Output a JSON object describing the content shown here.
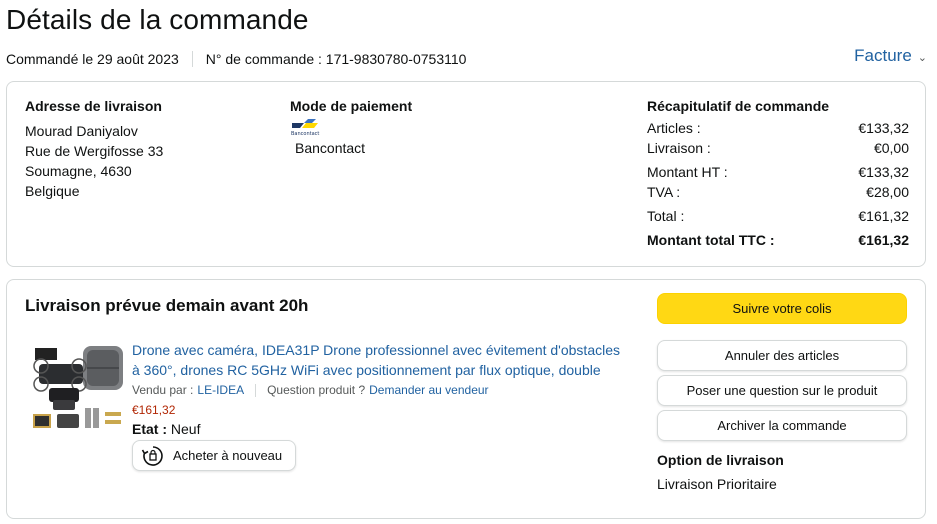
{
  "page": {
    "title": "Détails de la commande",
    "ordered_on": "Commandé le 29 août 2023",
    "order_number": "N° de commande : 171-9830780-0753110",
    "invoice_label": "Facture"
  },
  "shipping": {
    "heading": "Adresse de livraison",
    "lines": [
      "Mourad Daniyalov",
      "Rue de Wergifosse 33",
      "Soumagne, 4630",
      "Belgique"
    ]
  },
  "payment": {
    "heading": "Mode de paiement",
    "logo_text": "Bancontact",
    "method": "Bancontact"
  },
  "summary": {
    "heading": "Récapitulatif de commande",
    "rows": [
      {
        "label": "Articles :",
        "value": "€133,32"
      },
      {
        "label": "Livraison :",
        "value": "€0,00"
      },
      {
        "label": "Montant HT :",
        "value": "€133,32"
      },
      {
        "label": "TVA :",
        "value": "€28,00"
      },
      {
        "label": "Total :",
        "value": "€161,32"
      },
      {
        "label": "Montant total TTC :",
        "value": "€161,32"
      }
    ]
  },
  "delivery": {
    "heading": "Livraison prévue demain avant 20h",
    "product": {
      "title_line1": "Drone avec caméra, IDEA31P Drone professionnel avec évitement d'obstacles",
      "title_line2": "à 360°, drones RC 5GHz WiFi avec positionnement par flux optique, double",
      "sold_by_label": "Vendu par :",
      "sold_by": "LE-IDEA",
      "question_label": "Question produit ?",
      "question_link": "Demander au vendeur",
      "price": "€161,32",
      "condition_label": "Etat :",
      "condition": "Neuf",
      "rebuy_label": "Acheter à nouveau"
    },
    "buttons": {
      "track": "Suivre votre colis",
      "cancel": "Annuler des articles",
      "ask": "Poser une question sur le produit",
      "archive": "Archiver la commande"
    },
    "option_heading": "Option de livraison",
    "option_value": "Livraison Prioritaire"
  },
  "colors": {
    "link": "#2162a1",
    "price": "#b12704",
    "primary_button": "#ffd814",
    "border": "#d5d9d9"
  }
}
